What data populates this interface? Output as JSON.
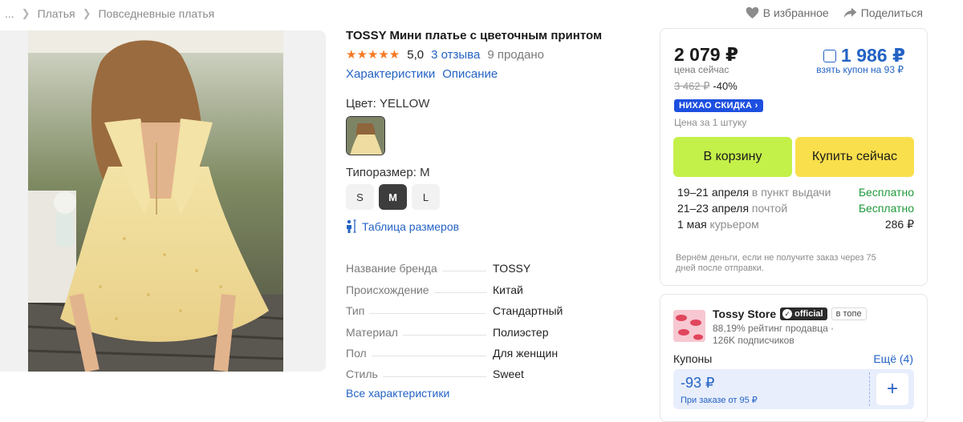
{
  "breadcrumb": {
    "ellipsis": "...",
    "items": [
      "Платья",
      "Повседневные платья"
    ]
  },
  "top_actions": {
    "favorite": "В избранное",
    "share": "Поделиться"
  },
  "product": {
    "title": "TOSSY Мини платье с цветочным принтом",
    "rating": "5,0",
    "reviews": "3 отзыва",
    "sold": "9 продано",
    "tabs": [
      "Характеристики",
      "Описание"
    ],
    "color_label": "Цвет: YELLOW",
    "size_label": "Типоразмер: M",
    "sizes": [
      "S",
      "M",
      "L"
    ],
    "selected_size": "M",
    "size_table": "Таблица размеров",
    "properties": [
      {
        "k": "Название бренда",
        "v": "TOSSY"
      },
      {
        "k": "Происхождение",
        "v": "Китай"
      },
      {
        "k": "Тип",
        "v": "Стандартный"
      },
      {
        "k": "Материал",
        "v": "Полиэстер"
      },
      {
        "k": "Пол",
        "v": "Для женщин"
      },
      {
        "k": "Стиль",
        "v": "Sweet"
      }
    ],
    "all_props": "Все характеристики"
  },
  "price": {
    "current": "2 079 ₽",
    "current_label": "цена сейчас",
    "coupon_price": "1 986 ₽",
    "coupon_label": "взять купон на 93 ₽",
    "old": "3 462 ₽",
    "discount": "-40%",
    "badge": "НИХАО СКИДКА ›",
    "per_unit": "Цена за 1 штуку",
    "cart_button": "В корзину",
    "buy_button": "Купить сейчас"
  },
  "delivery": [
    {
      "date": "19–21 апреля",
      "method": " в пункт выдачи",
      "price": "Бесплатно"
    },
    {
      "date": "21–23 апреля",
      "method": " почтой",
      "price": "Бесплатно"
    },
    {
      "date": "1 мая",
      "method": " курьером",
      "price": "286 ₽"
    }
  ],
  "refund_note": "Вернём деньги, если не получите заказ через 75 дней после отправки.",
  "store": {
    "name": "Tossy Store",
    "official": "official",
    "top_tag": "в топе",
    "rating_line": "88,19% рейтинг продавца ·",
    "subscribers": "126K подписчиков",
    "coupons_title": "Купоны",
    "coupons_more": "Ещё (4)",
    "coupon_amount": "-93 ₽",
    "coupon_condition": "При заказе от 95 ₽",
    "coupon_add": "+"
  },
  "colors": {
    "accent_blue": "#2463c4",
    "star_orange": "#f57a23",
    "cart_green": "#c4f04a",
    "buy_yellow": "#fadf4c",
    "free_green": "#1e9a3a",
    "badge_blue": "#1d4fe0"
  }
}
